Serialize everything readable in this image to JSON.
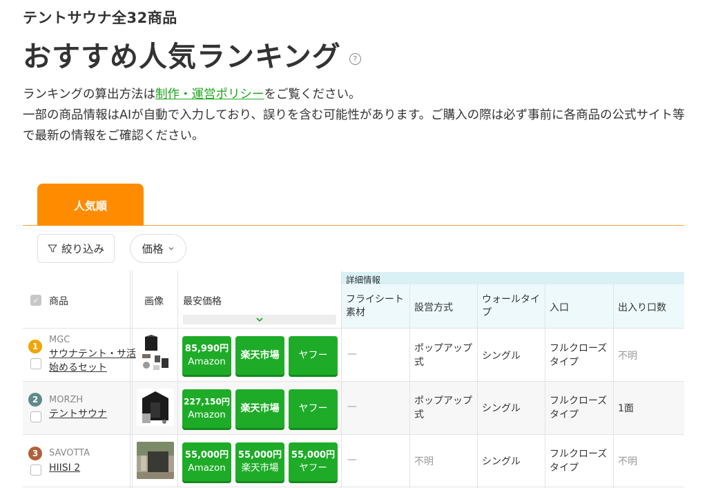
{
  "header": {
    "subtitle": "テントサウナ全32商品",
    "title": "おすすめ人気ランキング",
    "help_icon": "question-circle-icon"
  },
  "description": {
    "line1_prefix": "ランキングの算出方法は",
    "policy_link": "制作・運営ポリシー",
    "line1_suffix": "をご覧ください。",
    "line2": "一部の商品情報はAIが自動で入力しており、誤りを含む可能性があります。ご購入の際は必ず事前に各商品の公式サイト等で最新の情報をご確認ください。"
  },
  "tabs": [
    {
      "label": "人気順",
      "active": true
    }
  ],
  "filters": {
    "filter_label": "絞り込み",
    "price_label": "価格"
  },
  "table": {
    "group_header": "詳細情報",
    "headers": {
      "product": "商品",
      "image": "画像",
      "lowest_price": "最安価格",
      "flysheet": "フライシート素材",
      "setup": "設営方式",
      "wall": "ウォールタイプ",
      "entrance": "入口",
      "doors": "出入り口数"
    },
    "rows": [
      {
        "rank": "1",
        "rank_color": "#f0a500",
        "brand": "MGC",
        "name_line1": "サウナテント・サ活",
        "name_line2": "始めるセット",
        "amazon_price": "85,990円",
        "amazon_label": "Amazon",
        "rakuten_price": "",
        "rakuten_label": "楽天市場",
        "yahoo_price": "",
        "yahoo_label": "ヤフー",
        "flysheet": "—",
        "setup": "ポップアップ式",
        "wall": "シングル",
        "entrance": "フルクローズタイプ",
        "doors": "不明"
      },
      {
        "rank": "2",
        "rank_color": "#5f8a8b",
        "brand": "MORZH",
        "name_line1": "テントサウナ",
        "name_line2": "",
        "amazon_price": "227,150円",
        "amazon_label": "Amazon",
        "rakuten_price": "",
        "rakuten_label": "楽天市場",
        "yahoo_price": "",
        "yahoo_label": "ヤフー",
        "flysheet": "—",
        "setup": "ポップアップ式",
        "wall": "シングル",
        "entrance": "フルクローズタイプ",
        "doors": "1面"
      },
      {
        "rank": "3",
        "rank_color": "#b0603a",
        "brand": "SAVOTTA",
        "name_line1": "HIISI 2",
        "name_line2": "",
        "amazon_price": "55,000円",
        "amazon_label": "Amazon",
        "rakuten_price": "55,000円",
        "rakuten_label": "楽天市場",
        "yahoo_price": "55,000円",
        "yahoo_label": "ヤフー",
        "flysheet": "—",
        "setup": "不明",
        "wall": "シングル",
        "entrance": "フルクローズタイプ",
        "doors": "不明"
      }
    ]
  }
}
